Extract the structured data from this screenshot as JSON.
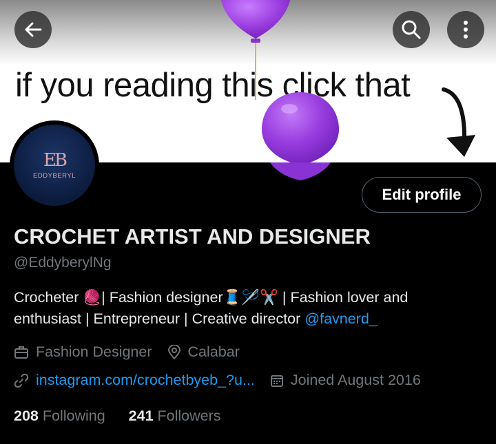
{
  "banner": {
    "caption": "if you reading this click that"
  },
  "icons": {
    "back": "arrow-left-icon",
    "search": "search-icon",
    "more": "more-vertical-icon",
    "job": "briefcase-icon",
    "location": "map-pin-icon",
    "link": "link-icon",
    "calendar": "calendar-icon"
  },
  "avatar": {
    "monogram": "EB",
    "brand": "EDDYBERYL"
  },
  "profile": {
    "edit_label": "Edit profile",
    "name": "CROCHET ARTIST AND DESIGNER",
    "handle": "@EddyberylNg",
    "bio": {
      "line1": "Crocheter 🧶| Fashion designer🧵🪡✂️ | Fashion lover and",
      "line2": "enthusiast | Entrepreneur | Creative director ",
      "mention": "@favnerd_"
    },
    "job": "Fashion Designer",
    "location": "Calabar",
    "website": "instagram.com/crochetbyeb_?u...",
    "joined": "Joined August 2016",
    "following_count": "208",
    "following_label": "Following",
    "followers_count": "241",
    "followers_label": "Followers"
  },
  "colors": {
    "accent": "#1d9bf0",
    "muted": "#71767b",
    "text": "#e7e9ea",
    "balloon": "#9d3fe0"
  }
}
